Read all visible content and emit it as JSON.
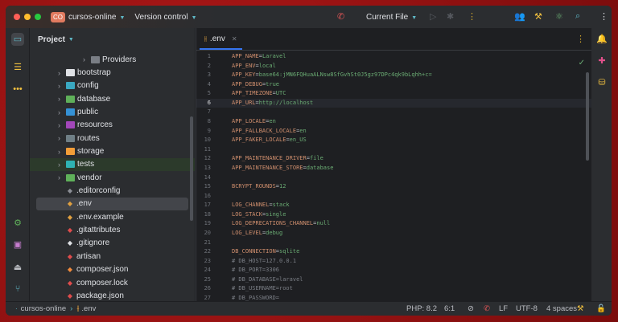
{
  "titlebar": {
    "project_badge": "CO",
    "project": "cursos-online",
    "vcs": "Version control",
    "run_config": "Current File"
  },
  "project_panel": {
    "title": "Project",
    "items": [
      {
        "label": "Providers",
        "type": "folder",
        "depth": 2,
        "color": "#7a7e85",
        "expandable": true
      },
      {
        "label": "bootstrap",
        "type": "folder",
        "depth": 1,
        "color": "#dfe1e5",
        "expandable": true
      },
      {
        "label": "config",
        "type": "folder",
        "depth": 1,
        "color": "#3aa8c1",
        "expandable": true
      },
      {
        "label": "database",
        "type": "folder",
        "depth": 1,
        "color": "#5fb05a",
        "expandable": true
      },
      {
        "label": "public",
        "type": "folder",
        "depth": 1,
        "color": "#3592d6",
        "expandable": true
      },
      {
        "label": "resources",
        "type": "folder",
        "depth": 1,
        "color": "#a347ba",
        "expandable": true
      },
      {
        "label": "routes",
        "type": "folder",
        "depth": 1,
        "color": "#6f7f86",
        "expandable": true
      },
      {
        "label": "storage",
        "type": "folder",
        "depth": 1,
        "color": "#f29d38",
        "expandable": true
      },
      {
        "label": "tests",
        "type": "folder",
        "depth": 1,
        "color": "#2fb3b3",
        "expandable": true,
        "highlight": true
      },
      {
        "label": "vendor",
        "type": "folder",
        "depth": 1,
        "color": "#5fb05a",
        "expandable": true
      },
      {
        "label": ".editorconfig",
        "type": "file",
        "depth": 1,
        "color": "#8c8f96"
      },
      {
        "label": ".env",
        "type": "file",
        "depth": 1,
        "color": "#e0a040",
        "selected": true
      },
      {
        "label": ".env.example",
        "type": "file",
        "depth": 1,
        "color": "#e0a040"
      },
      {
        "label": ".gitattributes",
        "type": "file",
        "depth": 1,
        "color": "#e04c4c"
      },
      {
        "label": ".gitignore",
        "type": "file",
        "depth": 1,
        "color": "#dfe1e5"
      },
      {
        "label": "artisan",
        "type": "file",
        "depth": 1,
        "color": "#e04c4c"
      },
      {
        "label": "composer.json",
        "type": "file",
        "depth": 1,
        "color": "#f08a3c"
      },
      {
        "label": "composer.lock",
        "type": "file",
        "depth": 1,
        "color": "#e04c4c"
      },
      {
        "label": "package.json",
        "type": "file",
        "depth": 1,
        "color": "#e04c4c"
      }
    ]
  },
  "editor": {
    "tab": ".env",
    "current_line": 6,
    "lines": [
      {
        "n": "1",
        "k": "APP_NAME",
        "v": "Laravel"
      },
      {
        "n": "2",
        "k": "APP_ENV",
        "v": "local"
      },
      {
        "n": "3",
        "k": "APP_KEY",
        "v": "base64:jMN6FQHuaALNsw8SfGvhSt0J5gz97DPc4qk9bLqhh+c="
      },
      {
        "n": "4",
        "k": "APP_DEBUG",
        "v": "true"
      },
      {
        "n": "5",
        "k": "APP_TIMEZONE",
        "v": "UTC"
      },
      {
        "n": "6",
        "k": "APP_URL",
        "v": "http://localhost"
      },
      {
        "n": "7"
      },
      {
        "n": "8",
        "k": "APP_LOCALE",
        "v": "en"
      },
      {
        "n": "9",
        "k": "APP_FALLBACK_LOCALE",
        "v": "en"
      },
      {
        "n": "10",
        "k": "APP_FAKER_LOCALE",
        "v": "en_US"
      },
      {
        "n": "11"
      },
      {
        "n": "12",
        "k": "APP_MAINTENANCE_DRIVER",
        "v": "file"
      },
      {
        "n": "13",
        "k": "APP_MAINTENANCE_STORE",
        "v": "database"
      },
      {
        "n": "14"
      },
      {
        "n": "15",
        "k": "BCRYPT_ROUNDS",
        "v": "12"
      },
      {
        "n": "16"
      },
      {
        "n": "17",
        "k": "LOG_CHANNEL",
        "v": "stack"
      },
      {
        "n": "18",
        "k": "LOG_STACK",
        "v": "single"
      },
      {
        "n": "19",
        "k": "LOG_DEPRECATIONS_CHANNEL",
        "v": "null"
      },
      {
        "n": "20",
        "k": "LOG_LEVEL",
        "v": "debug"
      },
      {
        "n": "21"
      },
      {
        "n": "22",
        "k": "DB_CONNECTION",
        "v": "sqlite"
      },
      {
        "n": "23",
        "c": "# DB_HOST=127.0.0.1"
      },
      {
        "n": "24",
        "c": "# DB_PORT=3306"
      },
      {
        "n": "25",
        "c": "# DB_DATABASE=laravel"
      },
      {
        "n": "26",
        "c": "# DB_USERNAME=root"
      },
      {
        "n": "27",
        "c": "# DB_PASSWORD="
      }
    ]
  },
  "statusbar": {
    "project": "cursos-online",
    "file": ".env",
    "php": "PHP: 8.2",
    "position": "6:1",
    "line_sep": "LF",
    "encoding": "UTF-8",
    "indent": "4 spaces"
  }
}
